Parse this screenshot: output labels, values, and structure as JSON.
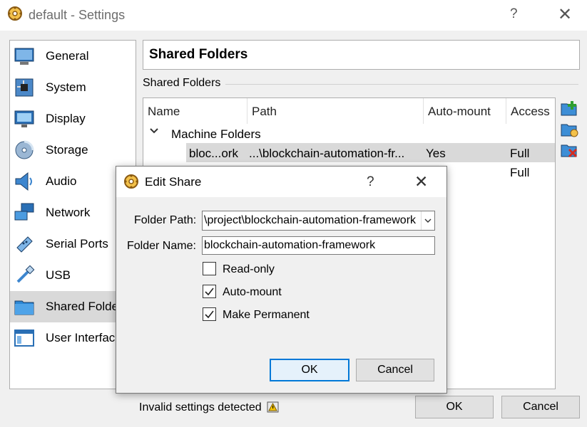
{
  "window": {
    "title": "default - Settings",
    "help": "?",
    "close": "✕"
  },
  "sidebar": {
    "items": [
      {
        "label": "General",
        "icon": "general-icon"
      },
      {
        "label": "System",
        "icon": "system-icon"
      },
      {
        "label": "Display",
        "icon": "display-icon"
      },
      {
        "label": "Storage",
        "icon": "storage-icon"
      },
      {
        "label": "Audio",
        "icon": "audio-icon"
      },
      {
        "label": "Network",
        "icon": "network-icon"
      },
      {
        "label": "Serial Ports",
        "icon": "serial-ports-icon"
      },
      {
        "label": "USB",
        "icon": "usb-icon"
      },
      {
        "label": "Shared Folders",
        "icon": "shared-folders-icon",
        "selected": true
      },
      {
        "label": "User Interface",
        "icon": "user-interface-icon"
      }
    ]
  },
  "page": {
    "title": "Shared Folders",
    "group_label": "Shared Folders"
  },
  "table": {
    "headers": [
      "Name",
      "Path",
      "Auto-mount",
      "Access"
    ],
    "group": "Machine Folders",
    "rows": [
      {
        "name": "bloc...ork",
        "path": "...\\blockchain-automation-fr...",
        "automount": "Yes",
        "access": "Full"
      },
      {
        "name": "",
        "path": "",
        "automount": "",
        "access": "Full"
      }
    ]
  },
  "status": {
    "text": "Invalid settings detected"
  },
  "buttons": {
    "ok": "OK",
    "cancel": "Cancel"
  },
  "dialog": {
    "title": "Edit Share",
    "help": "?",
    "close": "✕",
    "folder_path_label": "Folder Path:",
    "folder_path_value": "\\project\\blockchain-automation-framework",
    "folder_name_label": "Folder Name:",
    "folder_name_value": "blockchain-automation-framework",
    "checkboxes": [
      {
        "label": "Read-only",
        "checked": false
      },
      {
        "label": "Auto-mount",
        "checked": true
      },
      {
        "label": "Make Permanent",
        "checked": true
      }
    ],
    "ok": "OK",
    "cancel": "Cancel"
  },
  "colors": {
    "selection": "#d9d9d9",
    "default_button_border": "#0078d7",
    "default_button_bg": "#e5f1fb"
  }
}
